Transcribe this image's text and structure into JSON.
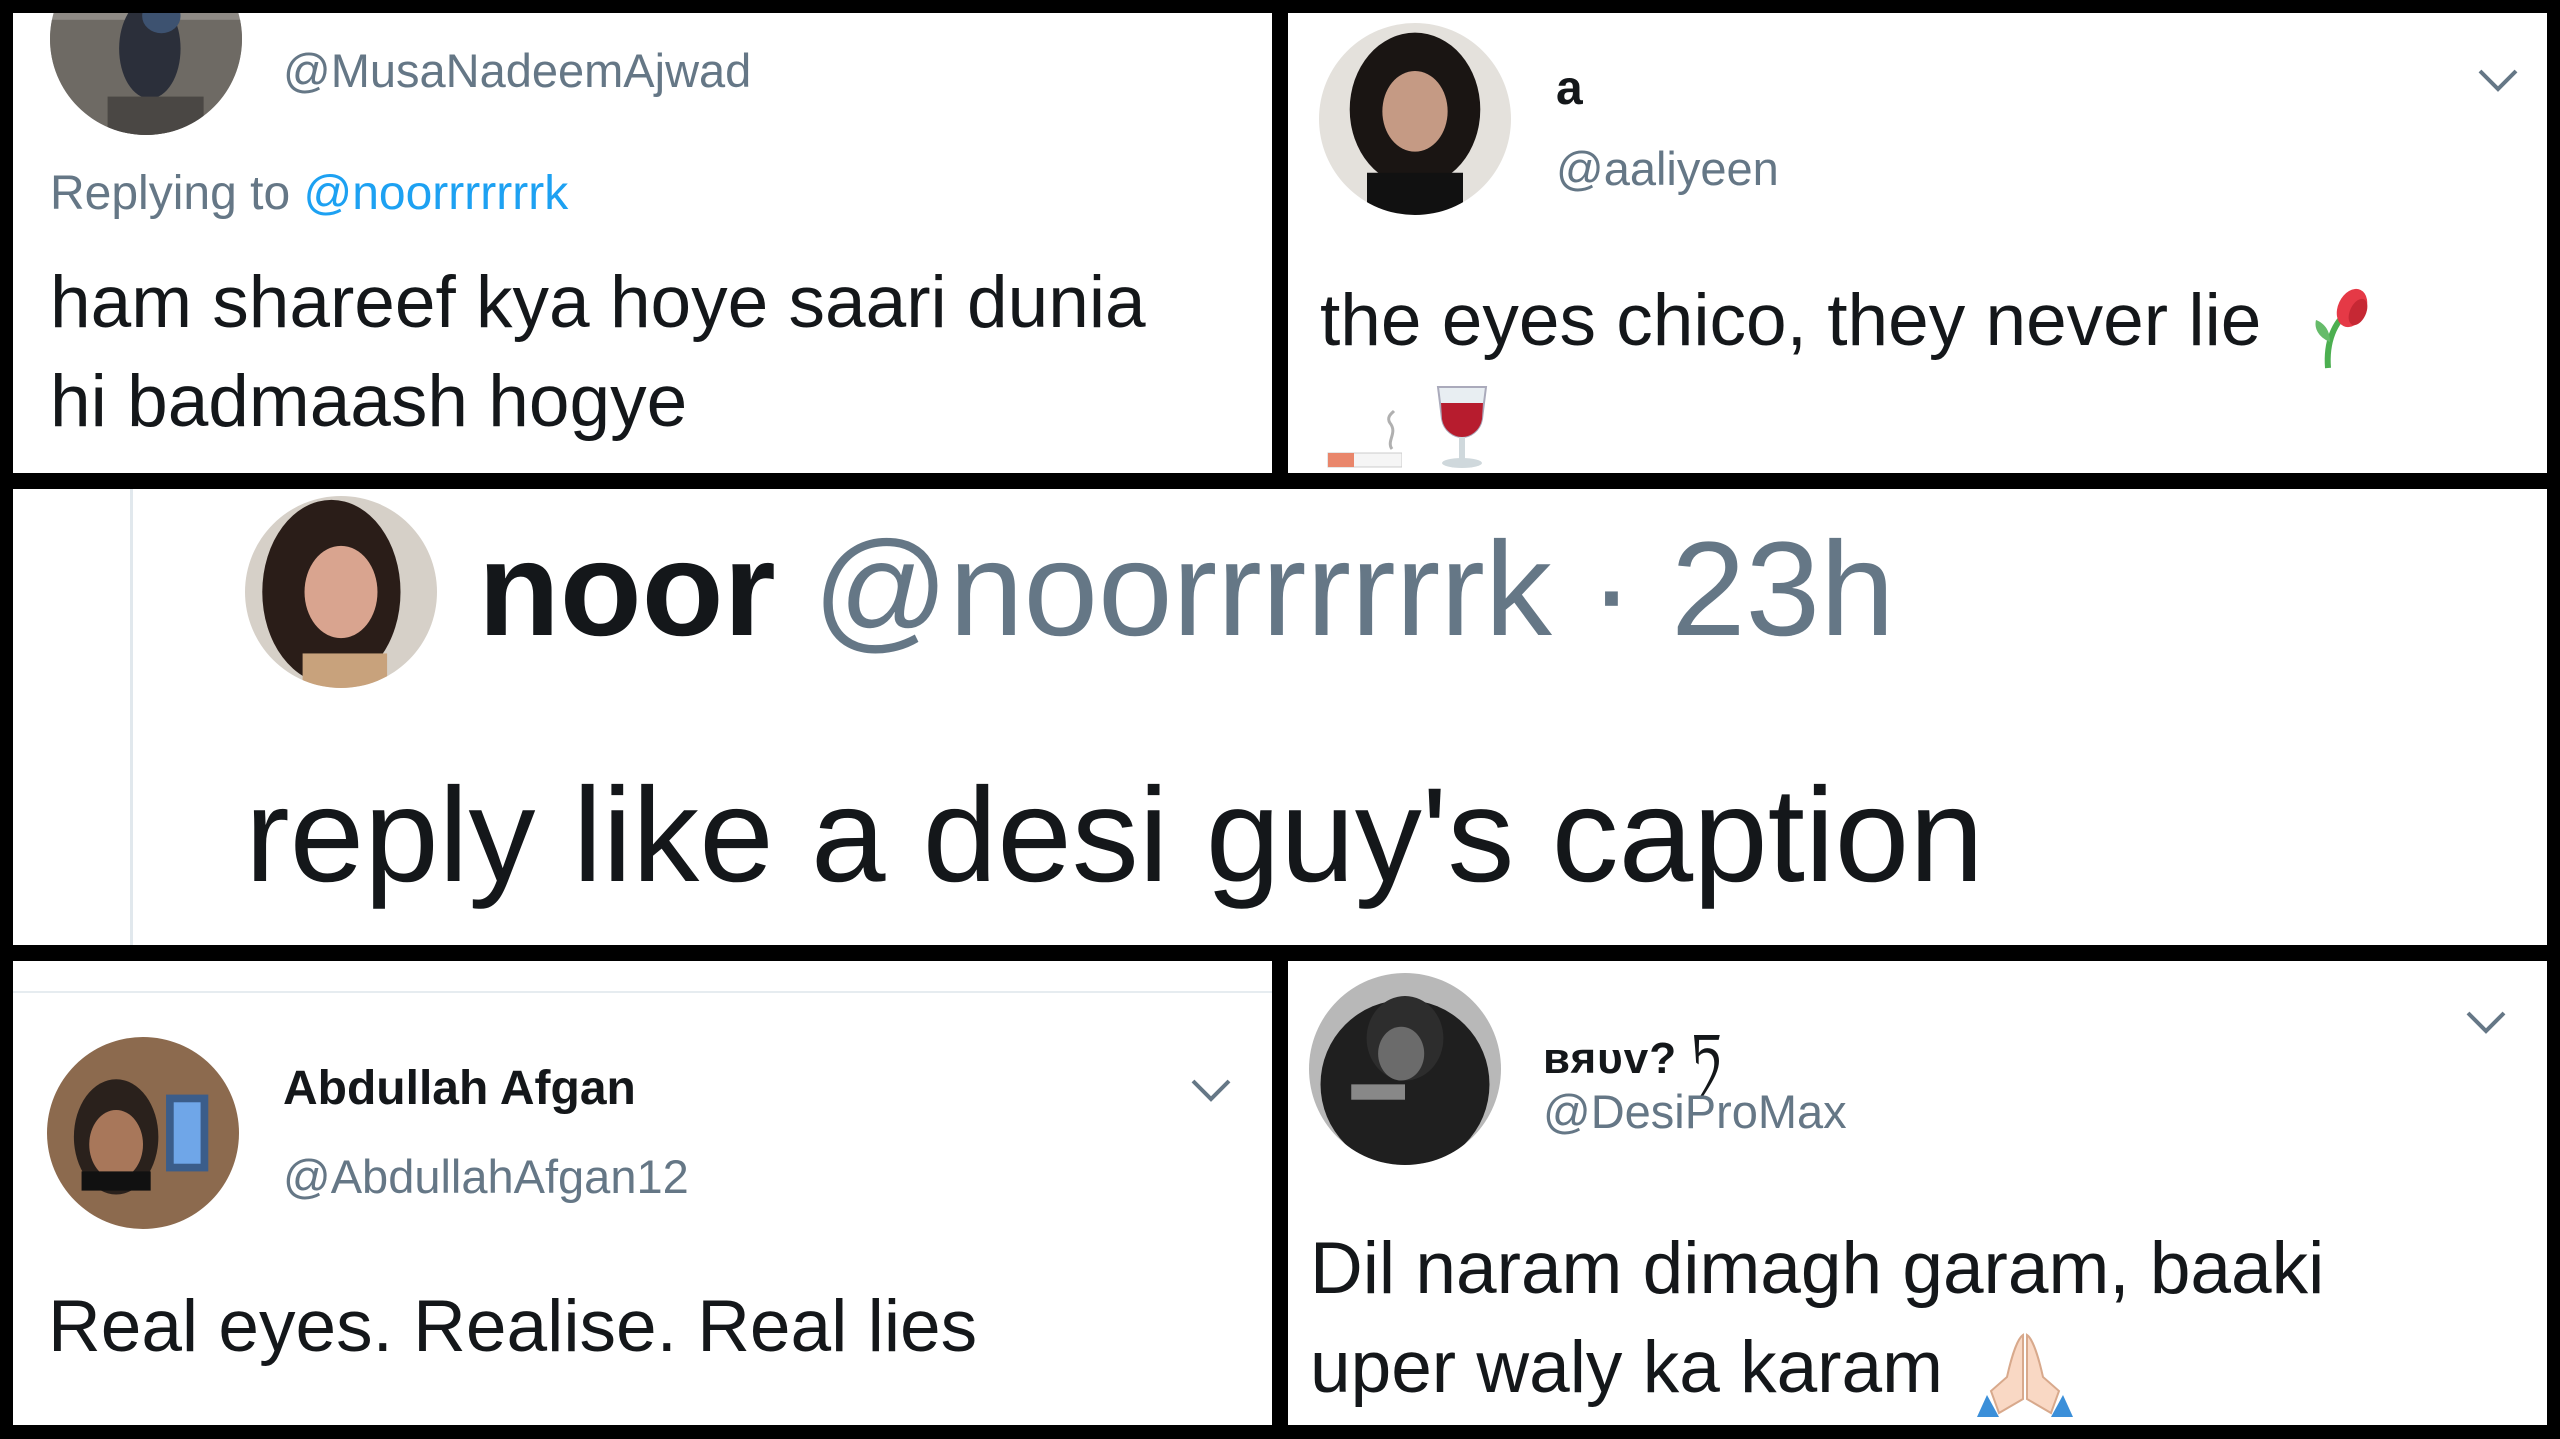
{
  "reply_top_left": {
    "handle": "@MusaNadeemAjwad",
    "replying_prefix": "Replying to",
    "replying_handle": "@noorrrrrrrk",
    "text_line1": "ham shareef kya hoye saari dunia",
    "text_line2": "hi badmaash hogye"
  },
  "reply_top_right": {
    "name": "a",
    "handle": "@aaliyeen",
    "text": "the eyes chico, they never lie",
    "emojis": [
      "wilted-flower-icon",
      "cigarette-icon",
      "wine-glass-icon"
    ]
  },
  "original_tweet": {
    "name": "noor",
    "handle": "@noorrrrrrrk",
    "separator": "·",
    "time": "23h",
    "text": "reply like a desi guy's caption"
  },
  "reply_bottom_left": {
    "name": "Abdullah Afgan",
    "handle": "@AbdullahAfgan12",
    "text": "Real eyes. Realise. Real lies"
  },
  "reply_bottom_right": {
    "name": "вяυv?",
    "name_glyph": "ཏ",
    "handle": "@DesiProMax",
    "text_line1": "Dil naram dimagh garam, baaki",
    "text_line2": "uper waly ka karam",
    "emojis": [
      "folded-hands-icon"
    ]
  },
  "colors": {
    "link_blue": "#1da1f2",
    "handle_gray": "#657786",
    "text_dark": "#14171a",
    "frame_black": "#000000"
  }
}
